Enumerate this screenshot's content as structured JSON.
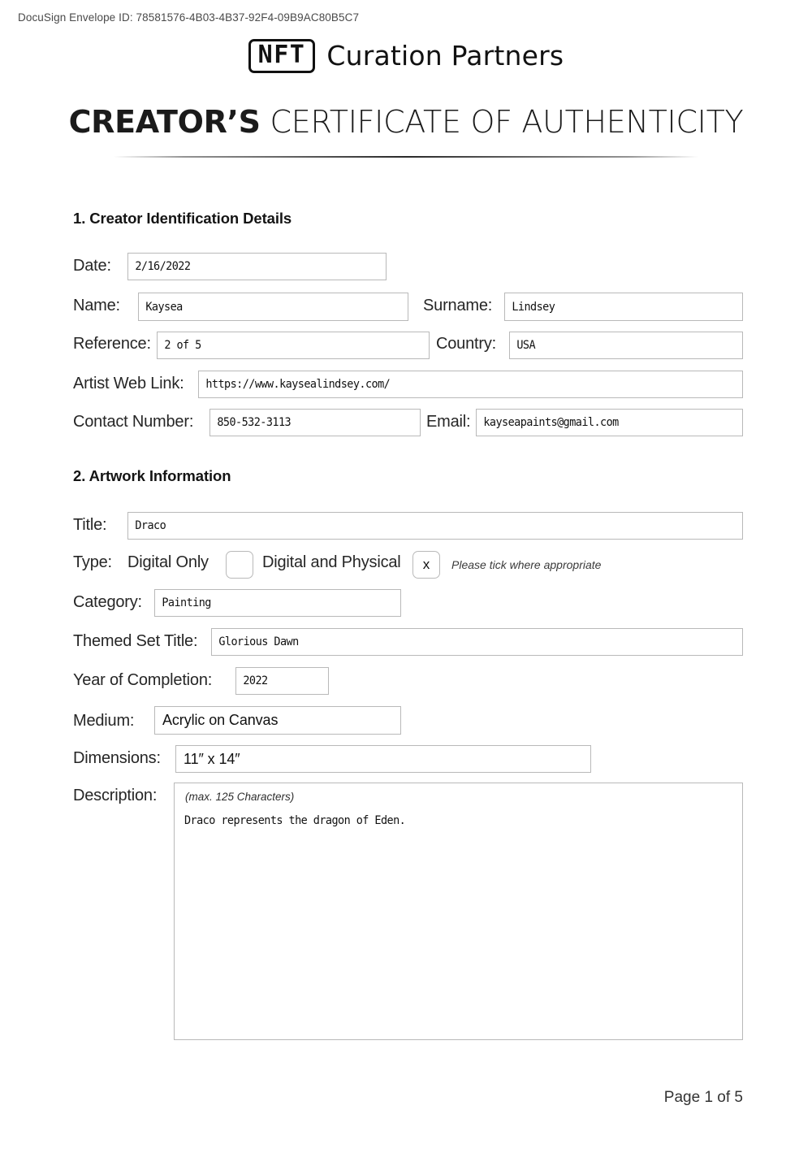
{
  "header": {
    "docusign_envelope": "DocuSign Envelope ID: 78581576-4B03-4B37-92F4-09B9AC80B5C7"
  },
  "logo": {
    "badge": "NFT",
    "wordmark": "Curation Partners"
  },
  "title": {
    "bold_part": "CREATOR’S",
    "rest_part": " CERTIFICATE OF AUTHENTICITY"
  },
  "sections": {
    "creator": {
      "heading": "1. Creator Identification Details",
      "fields": {
        "date": {
          "label": "Date:",
          "value": "2/16/2022"
        },
        "name": {
          "label": "Name:",
          "value": "Kaysea"
        },
        "surname": {
          "label": "Surname:",
          "value": "Lindsey"
        },
        "reference": {
          "label": "Reference:",
          "value": "2 of 5"
        },
        "country": {
          "label": "Country:",
          "value": "USA"
        },
        "web_link": {
          "label": "Artist Web Link:",
          "value": "https://www.kaysealindsey.com/"
        },
        "contact_number": {
          "label": "Contact Number:",
          "value": "850-532-3113"
        },
        "email": {
          "label": "Email:",
          "value": "kayseapaints@gmail.com"
        }
      }
    },
    "artwork": {
      "heading": "2. Artwork Information",
      "fields": {
        "art_title": {
          "label": "Title:",
          "value": "Draco"
        },
        "type": {
          "label": "Type:",
          "option_digital_only": "Digital Only",
          "option_digital_physical": "Digital and Physical",
          "digital_only_checked": "",
          "digital_physical_checked": "x",
          "hint": "Please tick where appropriate"
        },
        "category": {
          "label": "Category:",
          "value": "Painting"
        },
        "themed_set_title": {
          "label": "Themed Set Title:",
          "value": "Glorious Dawn"
        },
        "year_of_completion": {
          "label": "Year of Completion:",
          "value": "2022"
        },
        "medium": {
          "label": "Medium:",
          "value": "Acrylic on Canvas"
        },
        "dimensions": {
          "label": "Dimensions:",
          "value": "11″ x 14″"
        },
        "description": {
          "label": "Description:",
          "hint": "(max. 125 Characters)",
          "value": "Draco represents the dragon of Eden."
        }
      }
    }
  },
  "footer": {
    "page_indicator": "Page 1 of 5"
  },
  "colors": {
    "text": "#1a1a1a",
    "field_border": "#b9b9b9",
    "background": "#ffffff"
  }
}
